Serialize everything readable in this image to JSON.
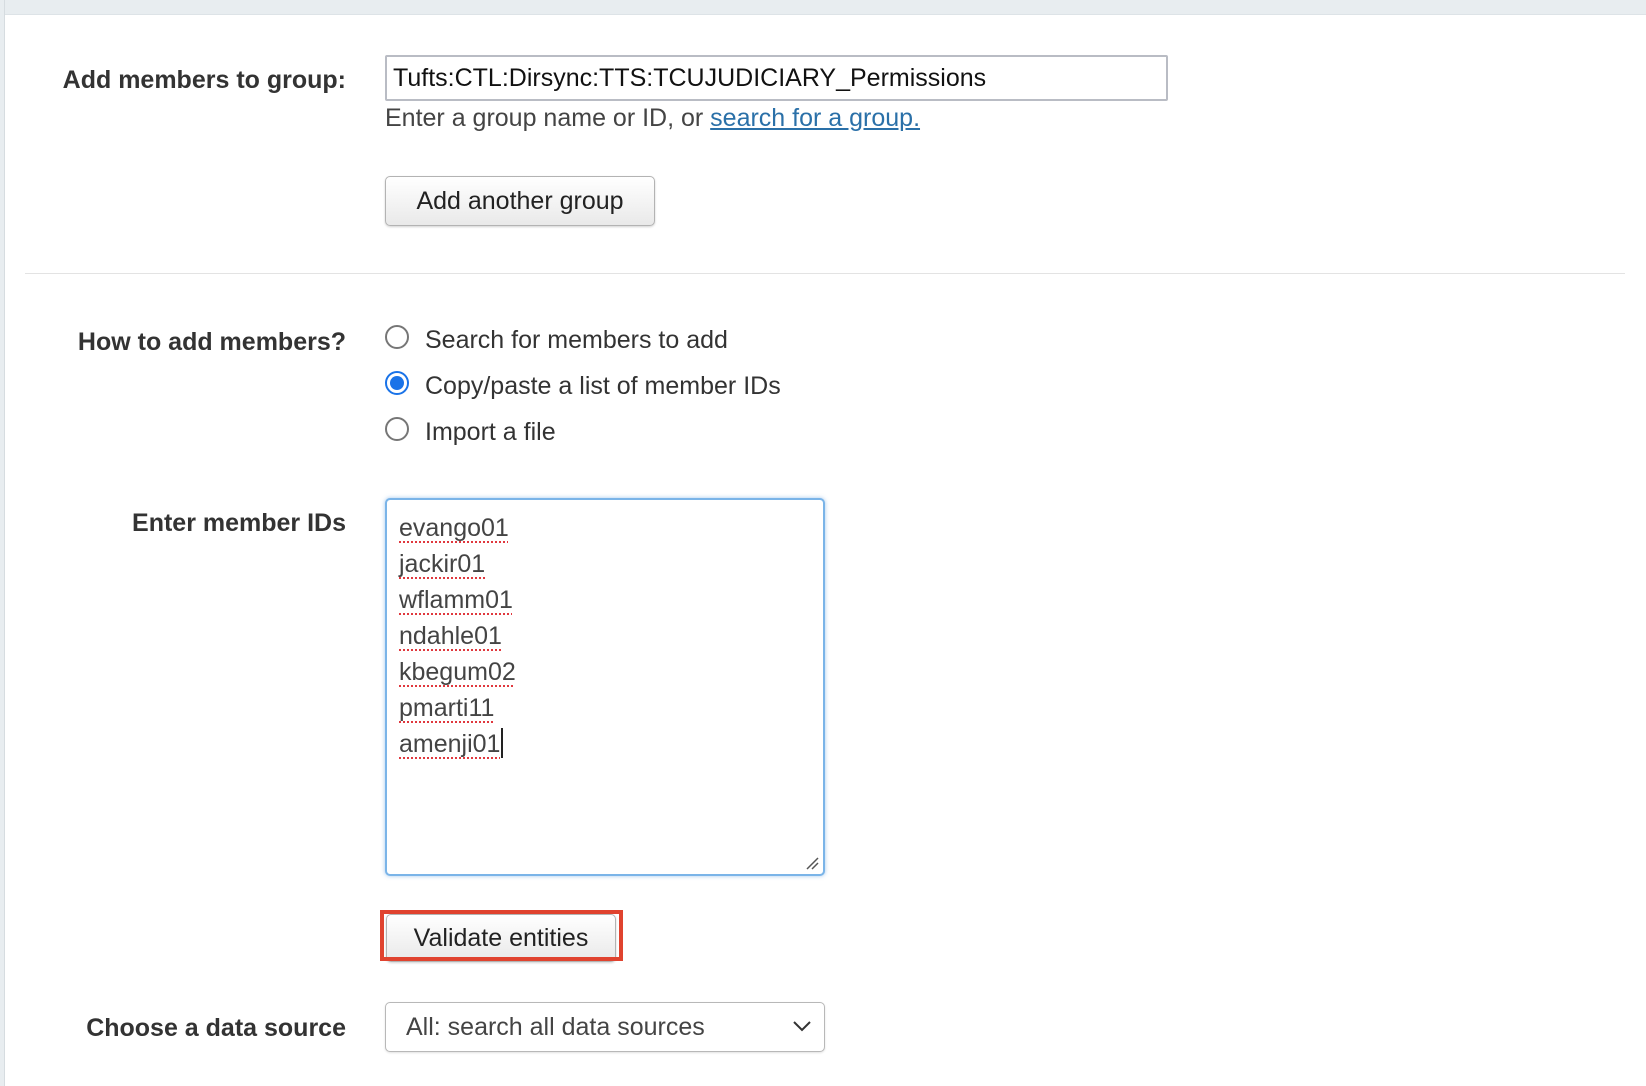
{
  "group_section": {
    "label": "Add members to group:",
    "group_value": "Tufts:CTL:Dirsync:TTS:TCUJUDICIARY_Permissions",
    "help_prefix": "Enter a group name or ID, or ",
    "help_link": "search for a group.",
    "add_another_label": "Add another group"
  },
  "method_section": {
    "label": "How to add members?",
    "options": [
      {
        "label": "Search for members to add",
        "checked": false
      },
      {
        "label": "Copy/paste a list of member IDs",
        "checked": true
      },
      {
        "label": "Import a file",
        "checked": false
      }
    ]
  },
  "ids_section": {
    "label": "Enter member IDs",
    "ids": [
      "evango01",
      "jackir01",
      "wflamm01",
      "ndahle01",
      "kbegum02",
      "pmarti11",
      "amenji01"
    ],
    "validate_label": "Validate entities"
  },
  "source_section": {
    "label": "Choose a data source",
    "selected": "All: search all data sources"
  },
  "colors": {
    "link": "#2a70a8",
    "radio_checked": "#1a73e8",
    "highlight": "#e0432f",
    "focus_border": "#7ab4e8"
  },
  "icons": {
    "dropdown": "chevron-down-icon",
    "resize": "resize-grip-icon"
  }
}
